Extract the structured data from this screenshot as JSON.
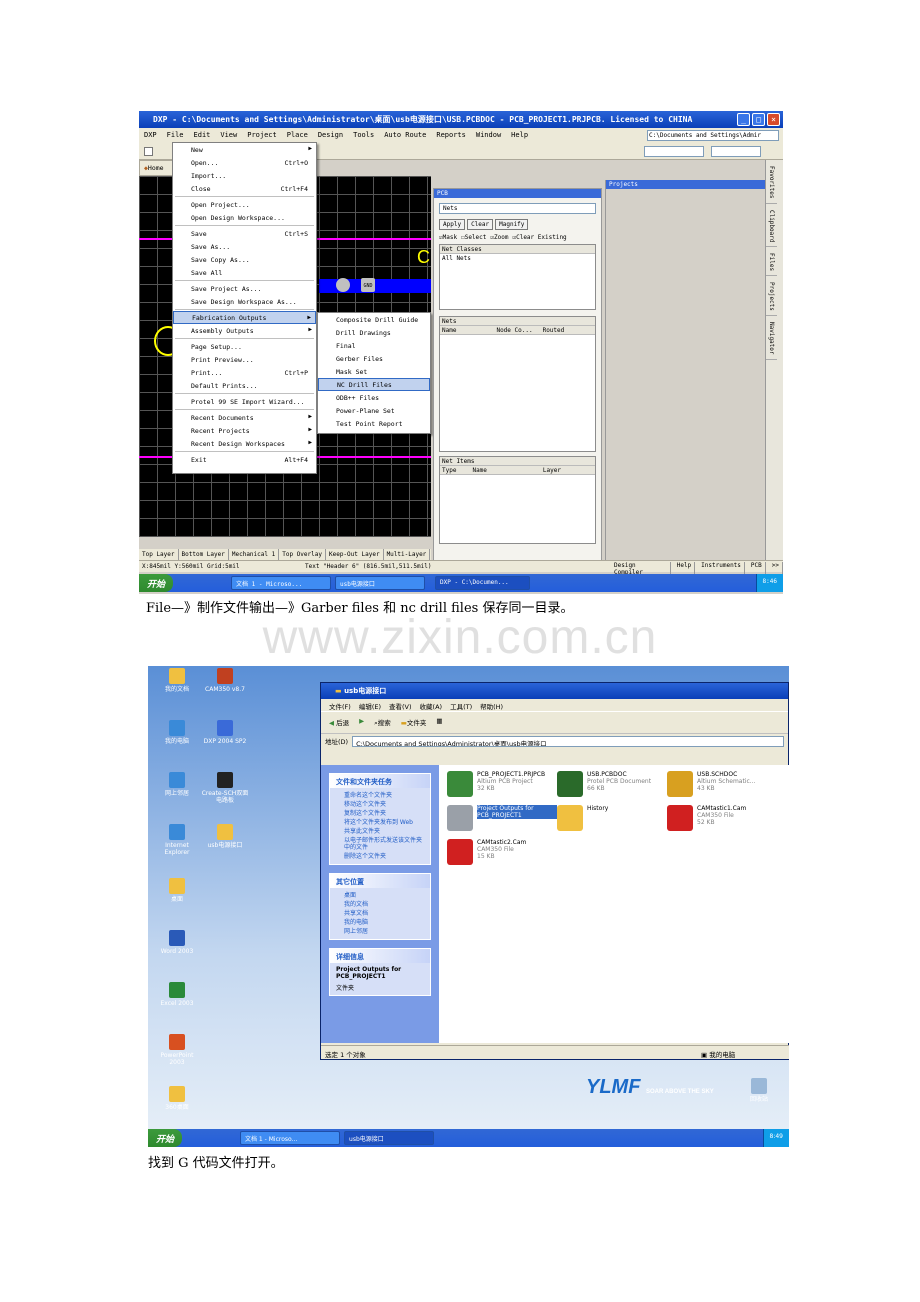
{
  "shot1": {
    "title": "DXP - C:\\Documents and Settings\\Administrator\\桌面\\usb电源接口\\USB.PCBDOC - PCB_PROJECT1.PRJPCB. Licensed to CHINA",
    "menubar": [
      "DXP",
      "File",
      "Edit",
      "View",
      "Project",
      "Place",
      "Design",
      "Tools",
      "Auto Route",
      "Reports",
      "Window",
      "Help"
    ],
    "path_field": "C:\\Documents and Settings\\Admir",
    "home_tab": "Home",
    "file_menu": {
      "items": [
        {
          "label": "New",
          "shortcut": "",
          "arrow": true
        },
        {
          "label": "Open...",
          "shortcut": "Ctrl+O"
        },
        {
          "label": "Import...",
          "shortcut": ""
        },
        {
          "label": "Close",
          "shortcut": "Ctrl+F4"
        },
        {
          "sep": true
        },
        {
          "label": "Open Project...",
          "shortcut": ""
        },
        {
          "label": "Open Design Workspace...",
          "shortcut": ""
        },
        {
          "sep": true
        },
        {
          "label": "Save",
          "shortcut": "Ctrl+S"
        },
        {
          "label": "Save As...",
          "shortcut": ""
        },
        {
          "label": "Save Copy As...",
          "shortcut": ""
        },
        {
          "label": "Save All",
          "shortcut": ""
        },
        {
          "sep": true
        },
        {
          "label": "Save Project As...",
          "shortcut": ""
        },
        {
          "label": "Save Design Workspace As...",
          "shortcut": ""
        },
        {
          "sep": true
        },
        {
          "label": "Fabrication Outputs",
          "shortcut": "",
          "arrow": true,
          "hl": true
        },
        {
          "label": "Assembly Outputs",
          "shortcut": "",
          "arrow": true
        },
        {
          "sep": true
        },
        {
          "label": "Page Setup...",
          "shortcut": ""
        },
        {
          "label": "Print Preview...",
          "shortcut": ""
        },
        {
          "label": "Print...",
          "shortcut": "Ctrl+P"
        },
        {
          "label": "Default Prints...",
          "shortcut": ""
        },
        {
          "sep": true
        },
        {
          "label": "Protel 99 SE Import Wizard...",
          "shortcut": ""
        },
        {
          "sep": true
        },
        {
          "label": "Recent Documents",
          "shortcut": "",
          "arrow": true
        },
        {
          "label": "Recent Projects",
          "shortcut": "",
          "arrow": true
        },
        {
          "label": "Recent Design Workspaces",
          "shortcut": "",
          "arrow": true
        },
        {
          "sep": true
        },
        {
          "label": "Exit",
          "shortcut": "Alt+F4"
        }
      ]
    },
    "fab_submenu": [
      "Composite Drill Guide",
      "Drill Drawings",
      "Final",
      "Gerber Files",
      "Mask Set",
      "NC Drill Files",
      "ODB++ Files",
      "Power-Plane Set",
      "Test Point Report"
    ],
    "fab_highlight": "NC Drill Files",
    "pcb_panel": {
      "title": "PCB",
      "dropdown": "Nets",
      "buttons": [
        "Apply",
        "Clear",
        "Magnify"
      ],
      "checks": [
        "Mask",
        "Select",
        "Zoom",
        "Clear Existing"
      ],
      "net_classes_header": "Net Classes",
      "net_classes_item": "All Nets",
      "nets_header": "Nets",
      "nets_cols": [
        "Name",
        "Node Co...",
        "Routed"
      ],
      "net_items_header": "Net Items",
      "net_items_cols": [
        "Type",
        "Name",
        "Layer"
      ]
    },
    "projects_panel_title": "Projects",
    "side_tabs": [
      "Favorites",
      "Clipboard",
      "Files",
      "Projects",
      "Navigator"
    ],
    "canvas_labels": [
      "GND",
      "C",
      "1"
    ],
    "layer_tabs": [
      "Top Layer",
      "Bottom Layer",
      "Mechanical 1",
      "Top Overlay",
      "Keep-Out Layer",
      "Multi-Layer"
    ],
    "status_left": "X:845mil Y:560mil   Grid:5mil",
    "status_mid": "Text \"Header 6\" (816.5mil,511.5mil) Top O",
    "status_right_tabs": [
      "Design Compiler",
      "Help",
      "Instruments",
      "PCB",
      ">>"
    ],
    "taskbar": {
      "start": "开始",
      "items": [
        "文档 1 - Microso...",
        "usb电源接口",
        "DXP - C:\\Documen..."
      ],
      "time": "8:46"
    }
  },
  "caption1": "File—》制作文件输出—》Garber files  和 nc drill files    保存同一目录。",
  "watermark": "www.zixin.com.cn",
  "shot2": {
    "desktop_icons": [
      "我的文档",
      "CAM350 v8.7",
      "我的电脑",
      "DXP 2004 SP2",
      "网上邻居",
      "Create-SCH双面电路板",
      "Internet Explorer",
      "usb电源接口",
      "桌面",
      "Word 2003",
      "Excel 2003",
      "PowerPoint 2003",
      "360桌面"
    ],
    "recycle": "回收站",
    "logo": "YLMF",
    "logo_tag": "SOAR ABOVE THE SKY",
    "window_title": "usb电源接口",
    "menubar": [
      "文件(F)",
      "编辑(E)",
      "查看(V)",
      "收藏(A)",
      "工具(T)",
      "帮助(H)"
    ],
    "toolbar": [
      "后退",
      "搜索",
      "文件夹"
    ],
    "address_label": "地址(D)",
    "address": "C:\\Documents and Settings\\Administrator\\桌面\\usb电源接口",
    "tasks": {
      "group1_title": "文件和文件夹任务",
      "group1": [
        "重命名这个文件夹",
        "移动这个文件夹",
        "复制这个文件夹",
        "将这个文件夹发布到 Web",
        "共享此文件夹",
        "以电子邮件形式发送该文件夹中的文件",
        "删除这个文件夹"
      ],
      "group2_title": "其它位置",
      "group2": [
        "桌面",
        "我的文档",
        "共享文档",
        "我的电脑",
        "网上邻居"
      ],
      "group3_title": "详细信息",
      "group3_name": "Project Outputs for PCB_PROJECT1",
      "group3_type": "文件夹"
    },
    "files": [
      {
        "name": "PCB_PROJECT1.PRJPCB",
        "type": "Altium PCB Project",
        "size": "32 KB",
        "color": "#3a8a3a"
      },
      {
        "name": "USB.PCBDOC",
        "type": "Protel PCB Document",
        "size": "66 KB",
        "color": "#2a6a2a"
      },
      {
        "name": "USB.SCHDOC",
        "type": "Altium Schematic...",
        "size": "43 KB",
        "color": "#d8a020"
      },
      {
        "name": "Project Outputs for PCB_PROJECT1",
        "type": "",
        "size": "",
        "color": "#9aa0a8",
        "selected": true
      },
      {
        "name": "History",
        "type": "",
        "size": "",
        "color": "#f0c040"
      },
      {
        "name": "CAMtastic1.Cam",
        "type": "CAM350 File",
        "size": "52 KB",
        "color": "#d02020"
      },
      {
        "name": "CAMtastic2.Cam",
        "type": "CAM350 File",
        "size": "15 KB",
        "color": "#d02020"
      }
    ],
    "status_left": "选定 1 个对象",
    "status_right": "我的电脑",
    "taskbar": {
      "start": "开始",
      "items": [
        "文档 1 - Microso...",
        "usb电源接口"
      ],
      "time": "8:49"
    }
  },
  "caption2": "找到 G 代码文件打开。"
}
